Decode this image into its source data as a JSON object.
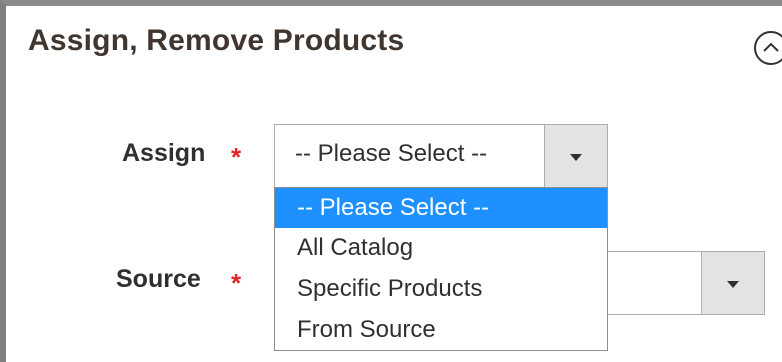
{
  "section": {
    "title": "Assign, Remove Products",
    "collapse_icon": "chevron-up-icon"
  },
  "fields": {
    "assign": {
      "label": "Assign",
      "required_mark": "*",
      "selected": "-- Please Select --",
      "options": [
        "-- Please Select --",
        "All Catalog",
        "Specific Products",
        "From Source"
      ],
      "highlighted_index": 0
    },
    "source": {
      "label": "Source",
      "required_mark": "*",
      "selected": ""
    }
  },
  "colors": {
    "required": "#e22626",
    "highlight": "#1e90ff"
  }
}
